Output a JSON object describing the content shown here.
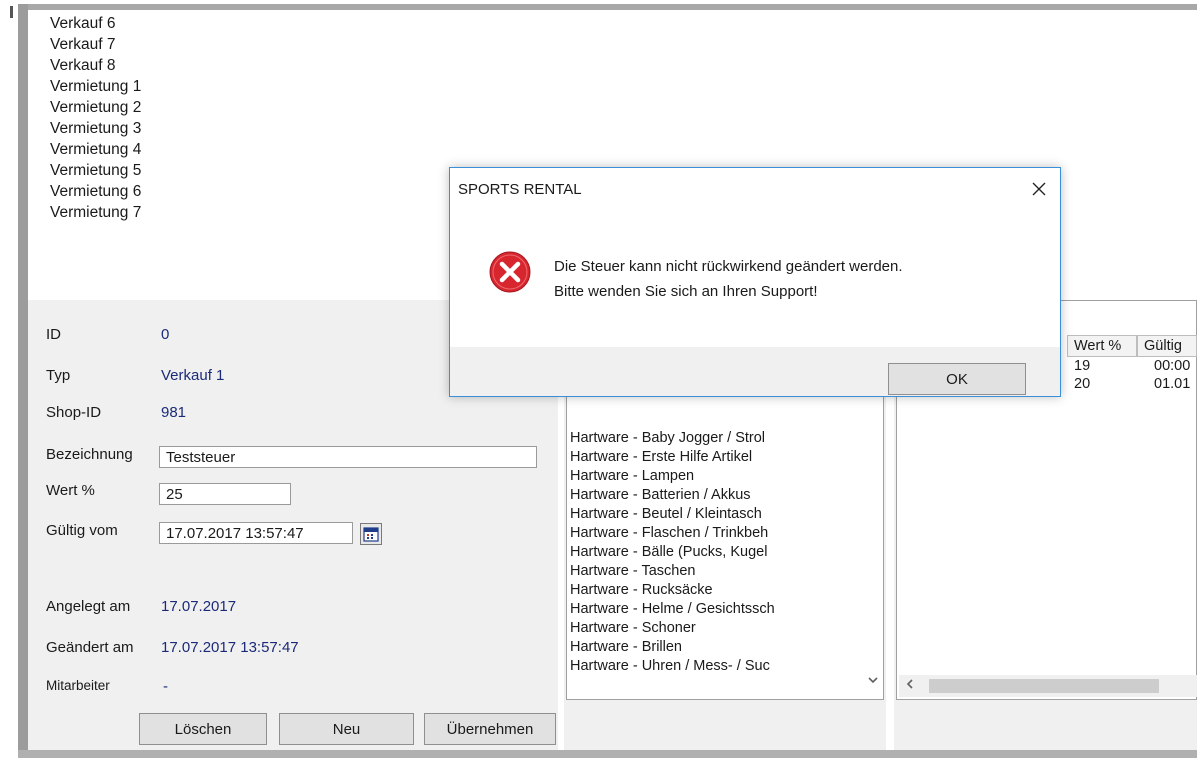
{
  "top_list": {
    "items": [
      "Verkauf 6",
      "Verkauf 7",
      "Verkauf 8",
      "Vermietung 1",
      "Vermietung 2",
      "Vermietung 3",
      "Vermietung 4",
      "Vermietung 5",
      "Vermietung 6",
      "Vermietung 7"
    ]
  },
  "form": {
    "id_label": "ID",
    "id_value": "0",
    "typ_label": "Typ",
    "typ_value": "Verkauf 1",
    "shop_label": "Shop-ID",
    "shop_value": "981",
    "bezeichnung_label": "Bezeichnung",
    "bezeichnung_value": "Teststeuer",
    "wert_label": "Wert %",
    "wert_value": "25",
    "gueltig_label": "Gültig vom",
    "gueltig_value": "17.07.2017 13:57:47",
    "angelegt_label": "Angelegt am",
    "angelegt_value": "17.07.2017",
    "geaendert_label": "Geändert am",
    "geaendert_value": "17.07.2017 13:57:47",
    "mitarbeiter_label": "Mitarbeiter",
    "mitarbeiter_value": "-"
  },
  "buttons": {
    "loeschen": "Löschen",
    "neu": "Neu",
    "uebernehmen": "Übernehmen"
  },
  "categories": {
    "items": [
      "Hartware - Baby Jogger / Strol",
      "Hartware - Erste Hilfe Artikel",
      "Hartware - Lampen",
      "Hartware - Batterien / Akkus",
      "Hartware - Beutel / Kleintasch",
      "Hartware - Flaschen / Trinkbeh",
      "Hartware - Bälle (Pucks, Kugel",
      "Hartware - Taschen",
      "Hartware - Rucksäcke",
      "Hartware - Helme / Gesichtssch",
      "Hartware - Schoner",
      "Hartware - Brillen",
      "Hartware - Uhren / Mess- / Suc"
    ]
  },
  "grid": {
    "headers": [
      "Wert %",
      "Gültig"
    ],
    "rows": [
      {
        "wert": "19",
        "gueltig": "00:00"
      },
      {
        "wert": "20",
        "gueltig": "01.01"
      }
    ]
  },
  "dialog": {
    "title": "SPORTS RENTAL",
    "message_line1": "Die Steuer kann nicht rückwirkend geändert werden.",
    "message_line2": "Bitte wenden Sie sich an Ihren Support!",
    "ok_label": "OK"
  },
  "icons": {
    "error": "error-icon",
    "close": "close-icon",
    "calendar": "calendar-icon",
    "scroll_down": "chevron-down-icon",
    "scroll_left": "chevron-left-icon"
  },
  "colors": {
    "error_red": "#d8262e",
    "dialog_border": "#3b8fd6",
    "value_blue": "#1b2a78"
  }
}
